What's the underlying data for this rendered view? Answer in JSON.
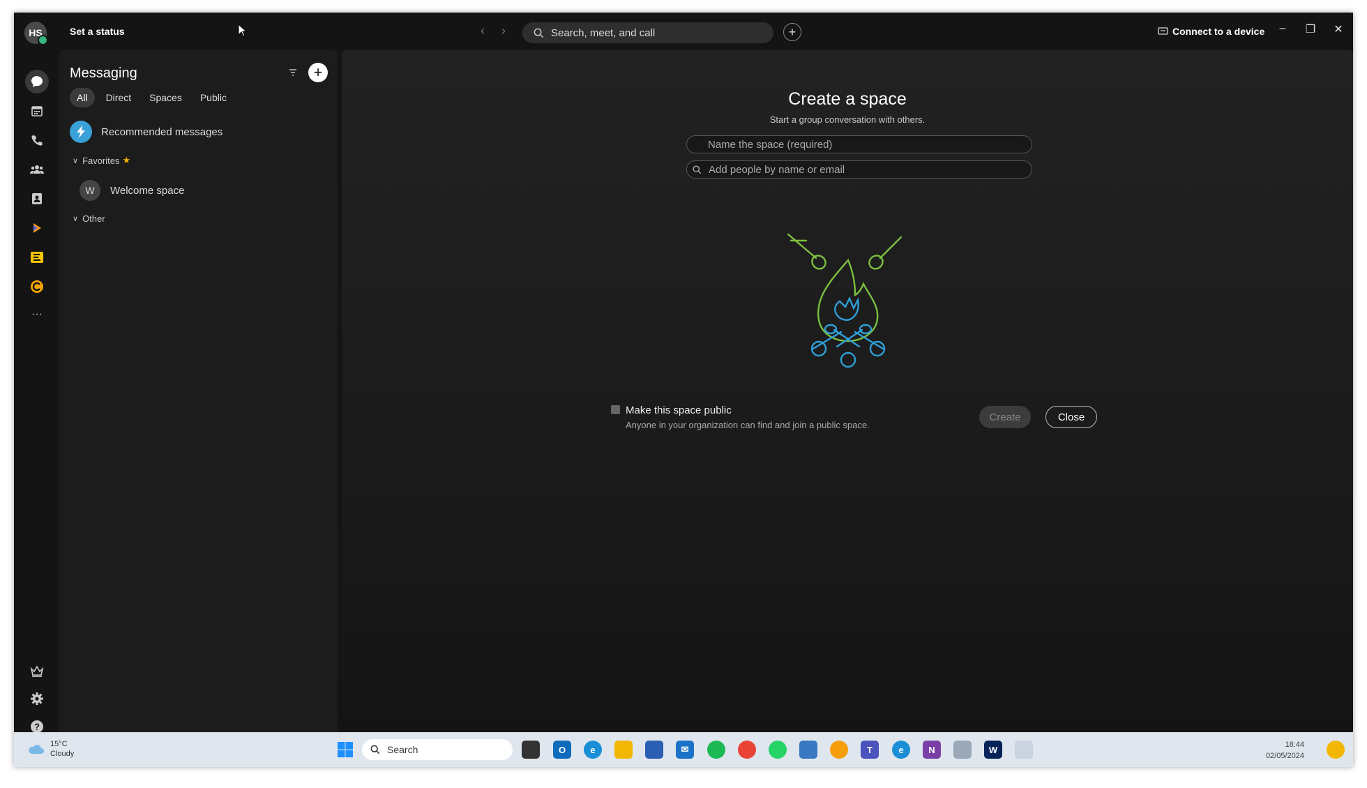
{
  "topbar": {
    "avatar_initials": "HS",
    "status_link": "Set a status",
    "search_placeholder": "Search, meet, and call",
    "connect_label": "Connect to a device"
  },
  "rail": {
    "items": [
      "messaging-icon",
      "calendar-icon",
      "phone-icon",
      "teams-icon",
      "contacts-icon",
      "webex-icon",
      "slido-icon",
      "app-icon",
      "more-icon"
    ],
    "more_label": "···"
  },
  "messaging": {
    "title": "Messaging",
    "tabs": [
      "All",
      "Direct",
      "Spaces",
      "Public"
    ],
    "active_tab": "All",
    "recommended_label": "Recommended messages",
    "favorites_label": "Favorites",
    "favorites_items": [
      {
        "initial": "W",
        "label": "Welcome space"
      }
    ],
    "other_label": "Other"
  },
  "create_space": {
    "title": "Create a space",
    "subtitle": "Start a group conversation with others.",
    "name_placeholder": "Name the space (required)",
    "people_placeholder": "Add people by name or email",
    "public_label": "Make this space public",
    "public_desc": "Anyone in your organization can find and join a public space.",
    "create_label": "Create",
    "close_label": "Close"
  },
  "taskbar": {
    "temperature": "15°C",
    "condition": "Cloudy",
    "search_label": "Search",
    "time": "18:44",
    "date": "02/05/2024"
  },
  "colors": {
    "accent_green": "#36b37e",
    "illustration_green": "#7cbf3f",
    "illustration_blue": "#2f9fd8"
  }
}
